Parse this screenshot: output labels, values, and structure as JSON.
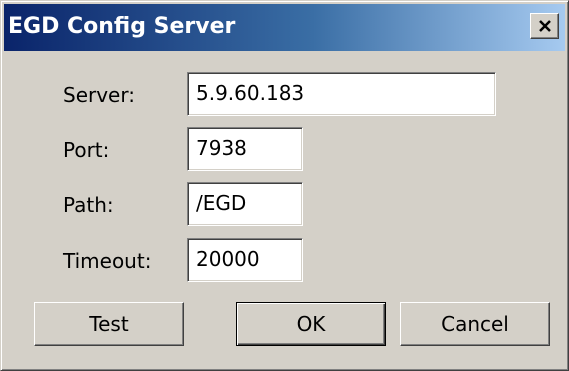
{
  "window": {
    "title": "EGD Config Server",
    "close_glyph": "×"
  },
  "fields": {
    "server": {
      "label": "Server:",
      "value": "5.9.60.183"
    },
    "port": {
      "label": "Port:",
      "value": "7938"
    },
    "path": {
      "label": "Path:",
      "value": "/EGD"
    },
    "timeout": {
      "label": "Timeout:",
      "value": "20000"
    }
  },
  "buttons": {
    "test": "Test",
    "ok": "OK",
    "cancel": "Cancel"
  },
  "icons": {
    "close": "close-icon"
  },
  "colors": {
    "title_gradient_start": "#0a246a",
    "title_gradient_end": "#a6caf0",
    "face": "#d4d0c8"
  }
}
